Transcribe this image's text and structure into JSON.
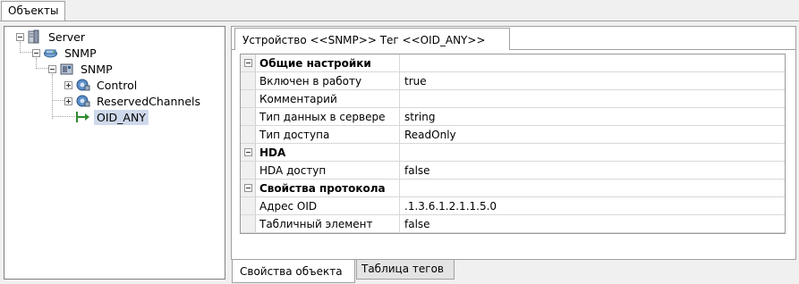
{
  "top_tab": {
    "label": "Объекты"
  },
  "tree": {
    "nodes": [
      {
        "label": "Server",
        "icon": "server-icon",
        "expander": "minus"
      },
      {
        "label": "SNMP",
        "icon": "network-device-icon",
        "expander": "minus"
      },
      {
        "label": "SNMP",
        "icon": "snmp-device-icon",
        "expander": "minus"
      },
      {
        "label": "Control",
        "icon": "channel-group-icon",
        "expander": "plus"
      },
      {
        "label": "ReservedChannels",
        "icon": "channel-group-icon",
        "expander": "plus"
      },
      {
        "label": "OID_ANY",
        "icon": "tag-arrow-icon",
        "expander": "none",
        "selected": true
      }
    ]
  },
  "details": {
    "tab_label": "Устройство <<SNMP>> Тег  <<OID_ANY>>",
    "sections": [
      {
        "title": "Общие настройки",
        "rows": [
          {
            "name": "Включен в работу",
            "value": "true"
          },
          {
            "name": "Комментарий",
            "value": ""
          },
          {
            "name": "Тип данных в сервере",
            "value": "string"
          },
          {
            "name": "Тип доступа",
            "value": "ReadOnly"
          }
        ]
      },
      {
        "title": "HDA",
        "rows": [
          {
            "name": "HDA доступ",
            "value": "false"
          }
        ]
      },
      {
        "title": "Свойства протокола",
        "rows": [
          {
            "name": "Адрес OID",
            "value": ".1.3.6.1.2.1.1.5.0"
          },
          {
            "name": "Табличный элемент",
            "value": "false"
          }
        ]
      }
    ]
  },
  "bottom_tabs": [
    {
      "label": "Свойства объекта",
      "active": true
    },
    {
      "label": "Таблица тегов",
      "active": false
    }
  ],
  "colors": {
    "selection": "#cfd9ec",
    "panel_bg": "#f0f0f0",
    "arrow_green": "#2e8b2e"
  }
}
